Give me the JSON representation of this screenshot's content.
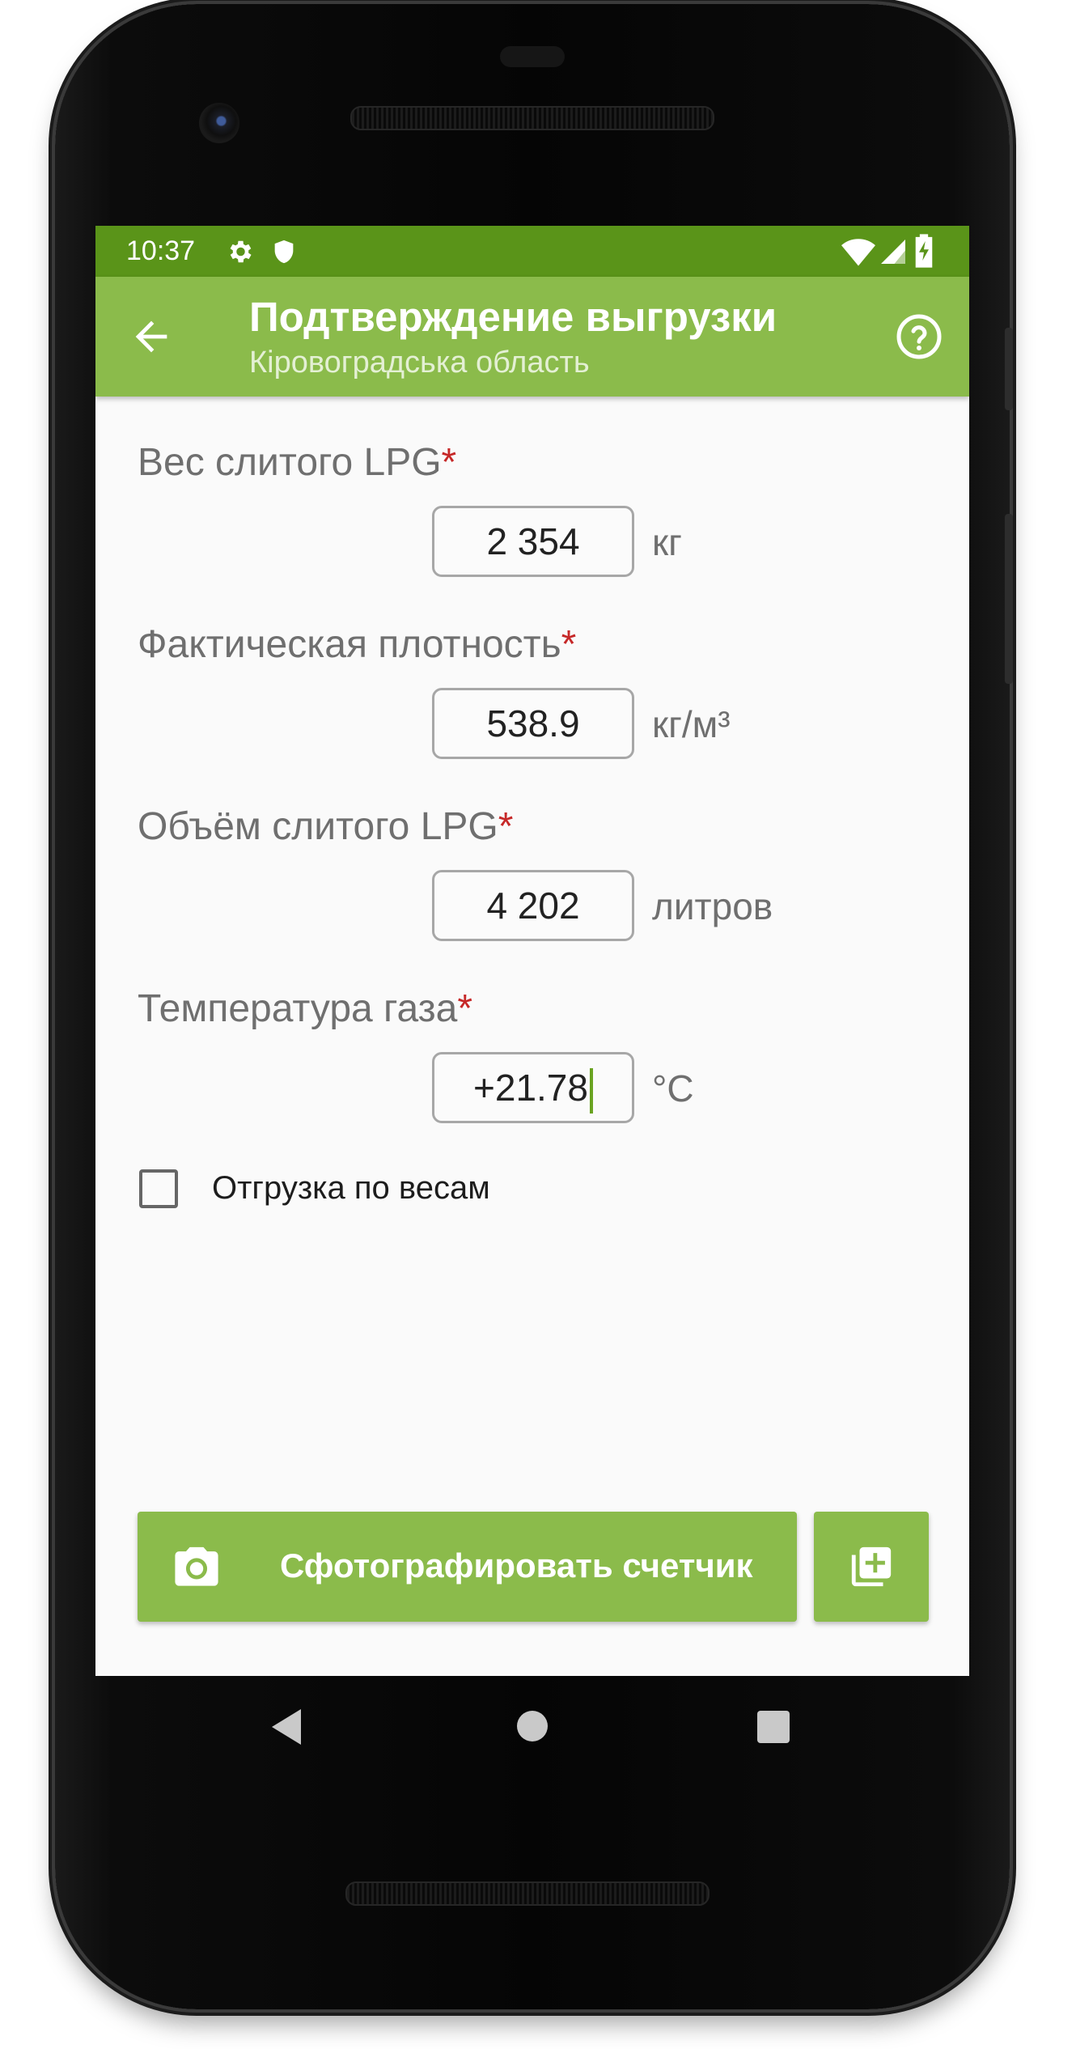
{
  "status_bar": {
    "time": "10:37",
    "icons": [
      "gear-icon",
      "shield-icon",
      "wifi-icon",
      "signal-icon",
      "battery-charging-icon"
    ]
  },
  "app_bar": {
    "title": "Подтверждение выгрузки",
    "subtitle": "Кіровоградська область",
    "icons": [
      "back-arrow-icon",
      "help-icon"
    ]
  },
  "form": {
    "required_mark": "*",
    "weight": {
      "label": "Вес слитого LPG",
      "value": "2 354",
      "unit": "кг"
    },
    "density": {
      "label": "Фактическая плотность",
      "value": "538.9",
      "unit": "кг/м³"
    },
    "volume": {
      "label": "Объём слитого LPG",
      "value": "4 202",
      "unit": "литров"
    },
    "temperature": {
      "label": "Температура газа",
      "value": "+21.78",
      "unit": "°C"
    },
    "by_weight": {
      "label": "Отгрузка по весам",
      "checked": false
    }
  },
  "actions": {
    "photo_button_label": "Сфотографировать счетчик",
    "photo_icon": "camera-icon",
    "add_icon": "add-photo-icon"
  },
  "colors": {
    "status_bar": "#5a9419",
    "primary": "#8bbb4b",
    "required": "#c62828",
    "caret": "#6aa321"
  },
  "nav_bar": {
    "icons": [
      "nav-back-icon",
      "nav-home-icon",
      "nav-recents-icon"
    ]
  }
}
